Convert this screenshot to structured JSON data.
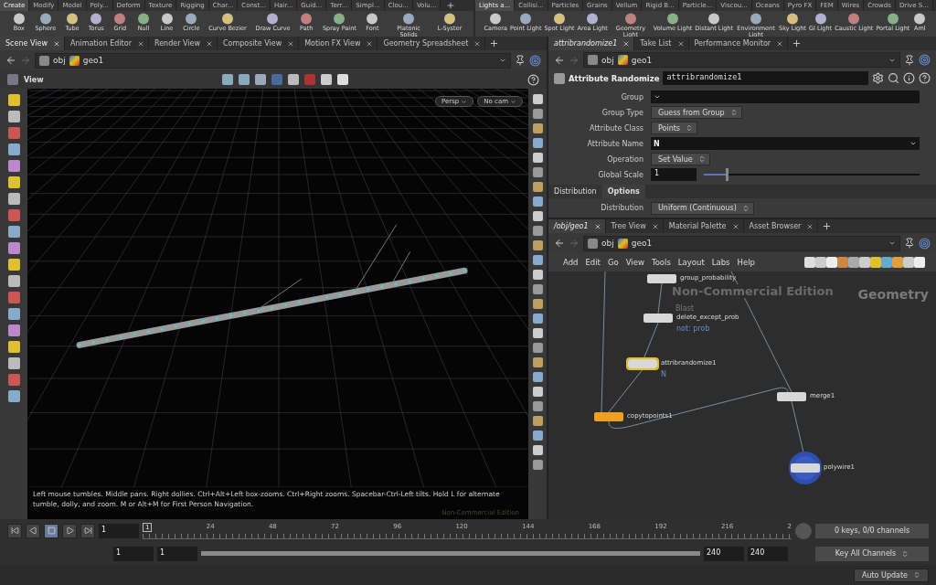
{
  "shelf_left": {
    "tabs": [
      {
        "label": "Create",
        "selected": true
      },
      {
        "label": "Modify",
        "selected": false
      },
      {
        "label": "Model",
        "selected": false
      },
      {
        "label": "Poly...",
        "selected": false
      },
      {
        "label": "Deform",
        "selected": false
      },
      {
        "label": "Texture",
        "selected": false
      },
      {
        "label": "Rigging",
        "selected": false
      },
      {
        "label": "Char...",
        "selected": false
      },
      {
        "label": "Const...",
        "selected": false
      },
      {
        "label": "Hair...",
        "selected": false
      },
      {
        "label": "Guid...",
        "selected": false
      },
      {
        "label": "Terr...",
        "selected": false
      },
      {
        "label": "Simpl...",
        "selected": false
      },
      {
        "label": "Clou...",
        "selected": false
      },
      {
        "label": "Volu...",
        "selected": false
      }
    ],
    "tools": [
      "Box",
      "Sphere",
      "Tube",
      "Torus",
      "Grid",
      "Null",
      "Line",
      "Circle",
      "Curve Bezier",
      "Draw Curve",
      "Path",
      "Spray Paint",
      "Font",
      "Platonic Solids",
      "L-Syster"
    ]
  },
  "shelf_right": {
    "tabs": [
      {
        "label": "Lights a...",
        "selected": true
      },
      {
        "label": "Collisi...",
        "selected": false
      },
      {
        "label": "Particles",
        "selected": false
      },
      {
        "label": "Grains",
        "selected": false
      },
      {
        "label": "Vellum",
        "selected": false
      },
      {
        "label": "Rigid B...",
        "selected": false
      },
      {
        "label": "Particle...",
        "selected": false
      },
      {
        "label": "Viscou...",
        "selected": false
      },
      {
        "label": "Oceans",
        "selected": false
      },
      {
        "label": "Pyro FX",
        "selected": false
      },
      {
        "label": "FEM",
        "selected": false
      },
      {
        "label": "Wires",
        "selected": false
      },
      {
        "label": "Crowds",
        "selected": false
      },
      {
        "label": "Drive S...",
        "selected": false
      }
    ],
    "tools": [
      "Camera",
      "Point Light",
      "Spot Light",
      "Area Light",
      "Geometry Light",
      "Volume Light",
      "Distant Light",
      "Environment Light",
      "Sky Light",
      "GI Light",
      "Caustic Light",
      "Portal Light",
      "Aml"
    ]
  },
  "scene_pane": {
    "tabs": [
      {
        "label": "Scene View",
        "selected": true
      },
      {
        "label": "Animation Editor",
        "selected": false
      },
      {
        "label": "Render View",
        "selected": false
      },
      {
        "label": "Composite View",
        "selected": false
      },
      {
        "label": "Motion FX View",
        "selected": false
      },
      {
        "label": "Geometry Spreadsheet",
        "selected": false
      }
    ],
    "path": [
      "obj",
      "geo1"
    ],
    "view_label": "View",
    "camera_buttons": [
      "Persp",
      "No cam"
    ],
    "help_text": "Left mouse tumbles. Middle pans. Right dollies. Ctrl+Alt+Left box-zooms. Ctrl+Right zooms. Spacebar-Ctrl-Left tilts. Hold L for alternate tumble, dolly, and zoom.     M or Alt+M for First Person Navigation.",
    "watermark": "Non-Commercial Edition"
  },
  "params_pane": {
    "tabs": [
      {
        "label": "attribrandomize1",
        "selected": true
      },
      {
        "label": "Take List",
        "selected": false
      },
      {
        "label": "Performance Monitor",
        "selected": false
      }
    ],
    "path": [
      "obj",
      "geo1"
    ],
    "node_type": "Attribute Randomize",
    "node_name": "attribrandomize1",
    "params": [
      {
        "kind": "field",
        "label": "Group"
      },
      {
        "kind": "menu",
        "label": "Group Type",
        "value": "Guess from Group"
      },
      {
        "kind": "menu",
        "label": "Attribute Class",
        "value": "Points"
      },
      {
        "kind": "field",
        "label": "Attribute Name",
        "value": "N"
      },
      {
        "kind": "menu",
        "label": "Operation",
        "value": "Set Value"
      },
      {
        "kind": "slider",
        "label": "Global Scale",
        "value": "1",
        "level": 0.1
      }
    ],
    "subtabs": [
      {
        "label": "Distribution",
        "selected": false
      },
      {
        "label": "Options",
        "selected": true
      }
    ],
    "sub_params": [
      {
        "kind": "menu",
        "label": "Distribution",
        "value": "Uniform (Continuous)"
      }
    ]
  },
  "network_pane": {
    "tabs": [
      {
        "label": "/obj/geo1",
        "selected": true
      },
      {
        "label": "Tree View",
        "selected": false
      },
      {
        "label": "Material Palette",
        "selected": false
      },
      {
        "label": "Asset Browser",
        "selected": false
      }
    ],
    "path": [
      "obj",
      "geo1"
    ],
    "menu": [
      "Add",
      "Edit",
      "Go",
      "View",
      "Tools",
      "Layout",
      "Labs",
      "Help"
    ],
    "watermark": "Non-Commercial Edition",
    "context_label": "Geometry",
    "nodes": [
      {
        "name": "group_probability",
        "color": "#d8d8d8",
        "selected": false,
        "display": false
      },
      {
        "name": "delete_except_prob",
        "type_label": "Blast",
        "comment": "not: prob",
        "color": "#d8d8d8",
        "selected": false,
        "display": false
      },
      {
        "name": "attribrandomize1",
        "comment": "N",
        "color": "#d8d8d8",
        "selected": true,
        "display": false
      },
      {
        "name": "copytopoints1",
        "color": "#f0a020",
        "selected": false,
        "display": false
      },
      {
        "name": "merge1",
        "color": "#d8d8d8",
        "selected": false,
        "display": false
      },
      {
        "name": "polywire1",
        "color": "#d8d8d8",
        "selected": false,
        "display": true
      }
    ]
  },
  "playbar": {
    "frame": "1",
    "ruler": [
      "1",
      "24",
      "48",
      "72",
      "96",
      "120",
      "144",
      "168",
      "192",
      "216",
      "2"
    ],
    "range_start": "1",
    "range_start_2": "1",
    "range_end": "240",
    "range_end_2": "240",
    "level": 1,
    "keys_info": "0 keys, 0/0 channels",
    "key_mode": "Key All Channels"
  },
  "status_bar": {
    "update_mode": "Auto Update"
  }
}
